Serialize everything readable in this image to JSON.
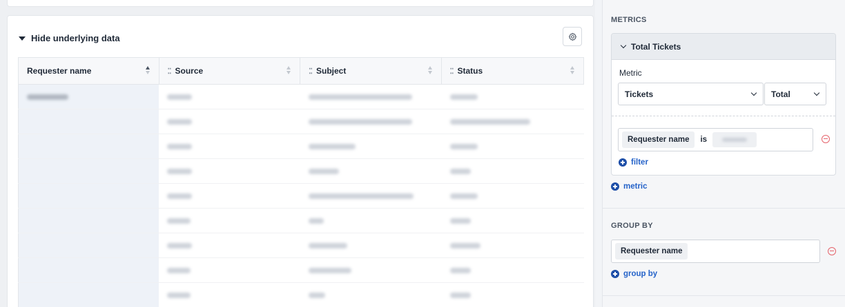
{
  "data_panel": {
    "toggle_label": "Hide underlying data",
    "columns": [
      {
        "label": "Requester name",
        "grip": false,
        "sort": "asc"
      },
      {
        "label": "Source",
        "grip": true,
        "sort": "none"
      },
      {
        "label": "Subject",
        "grip": true,
        "sort": "none"
      },
      {
        "label": "Status",
        "grip": true,
        "sort": "none"
      }
    ]
  },
  "sidebar": {
    "metrics_heading": "METRICS",
    "metric_card_title": "Total Tickets",
    "metric_label": "Metric",
    "metric_select": "Tickets",
    "aggregate_select": "Total",
    "filter": {
      "field": "Requester name",
      "operator": "is"
    },
    "add_filter": "filter",
    "add_metric": "metric",
    "group_by_heading": "GROUP BY",
    "group_by_field": "Requester name",
    "add_group_by": "group by"
  },
  "colors": {
    "accent": "#2563c9",
    "remove": "#e5636b"
  }
}
